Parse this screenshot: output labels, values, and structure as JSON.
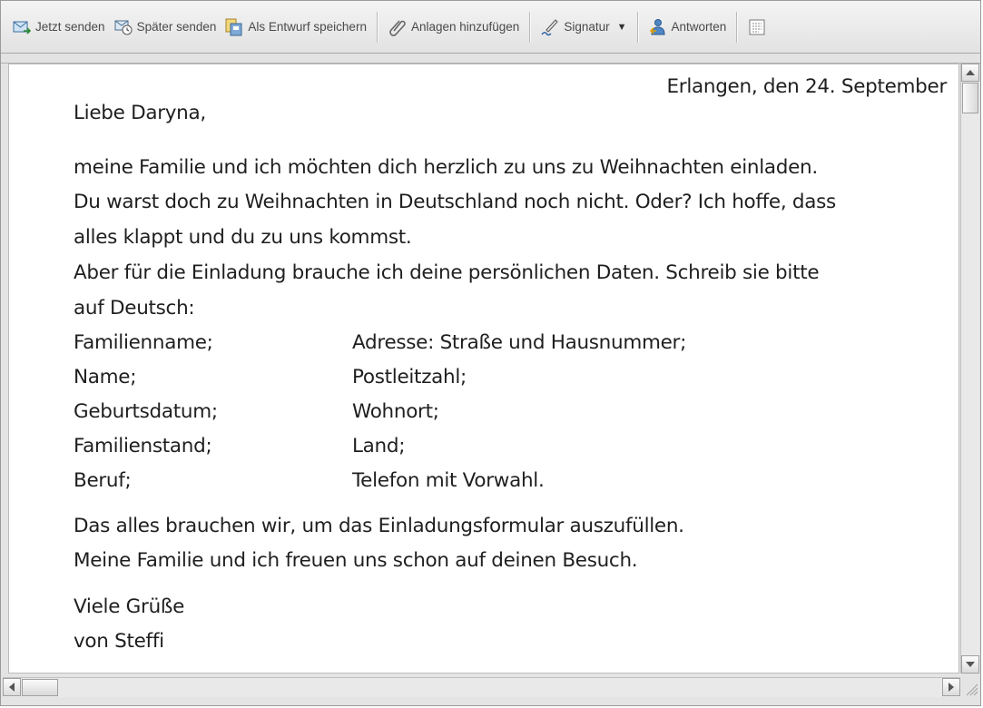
{
  "toolbar": {
    "send_now": "Jetzt senden",
    "send_later": "Später senden",
    "save_draft": "Als Entwurf speichern",
    "add_attachments": "Anlagen hinzufügen",
    "signature": "Signatur",
    "reply": "Antworten"
  },
  "letter": {
    "date": "Erlangen, den 24. September",
    "greeting": "Liebe Daryna,",
    "para1": [
      "meine Familie und ich möchten dich herzlich zu uns zu Weihnachten einladen.",
      "Du warst doch zu Weihnachten in Deutschland noch nicht. Oder? Ich hoffe, dass",
      "alles klappt und du zu uns kommst.",
      "Aber für die Einladung brauche ich deine persönlichen Daten. Schreib sie bitte",
      "auf Deutsch:"
    ],
    "fields_left": [
      "Familienname;",
      "Name;",
      "Geburtsdatum;",
      "Familienstand;",
      "Beruf;"
    ],
    "fields_right": [
      "Adresse: Straße und Hausnummer;",
      "Postleitzahl;",
      "Wohnort;",
      "Land;",
      "Telefon mit Vorwahl."
    ],
    "para2": [
      "Das alles brauchen wir, um das Einladungsformular auszufüllen.",
      "Meine Familie und ich freuen uns schon auf deinen Besuch."
    ],
    "closing": [
      "Viele Grüße",
      "von Steffi"
    ]
  },
  "icons": {
    "send_now": "envelope-send-icon",
    "send_later": "clock-envelope-icon",
    "save_draft": "draft-document-icon",
    "add_attachments": "paperclip-icon",
    "signature": "pen-signature-icon",
    "reply": "reply-person-icon",
    "more": "options-grid-icon"
  }
}
